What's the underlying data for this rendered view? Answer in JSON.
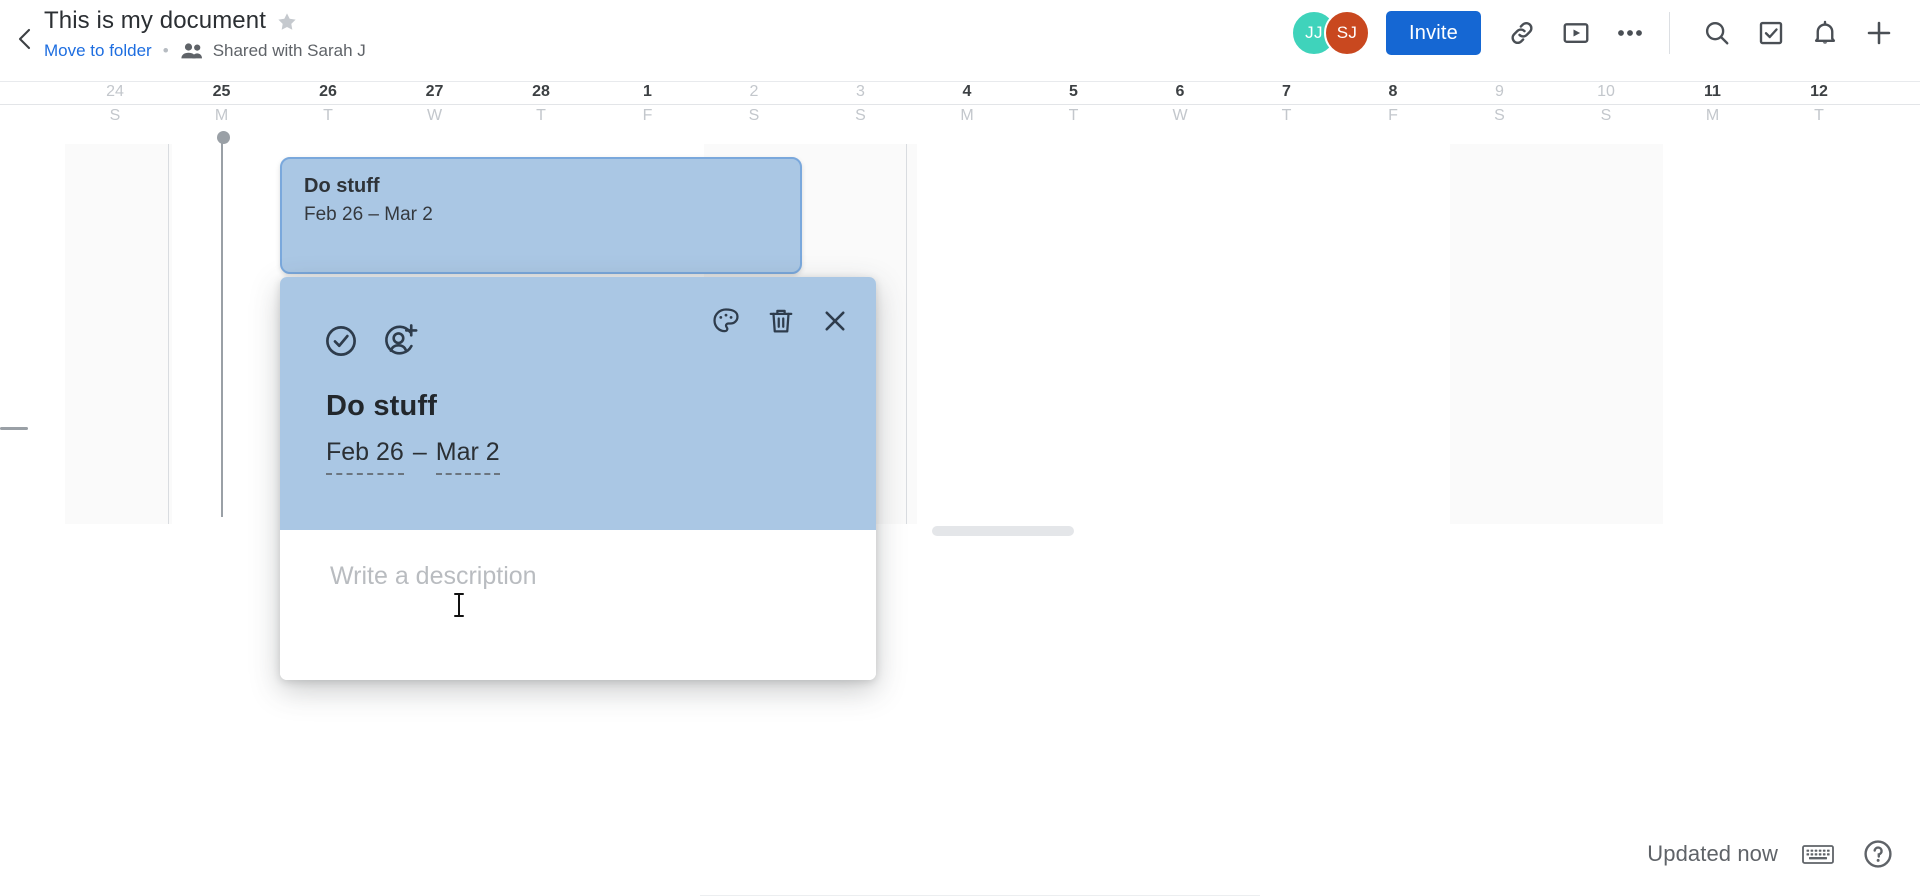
{
  "header": {
    "back_icon": "chevron-left-icon",
    "doc_title": "This is my document",
    "star_icon": "star-icon",
    "move_to_folder": "Move to folder",
    "separator_dot": "•",
    "people_icon": "people-icon",
    "shared_with": "Shared with Sarah J",
    "avatars": [
      {
        "initials": "JJ",
        "color": "#3fd3bb"
      },
      {
        "initials": "SJ",
        "color": "#c9481f"
      }
    ],
    "invite_label": "Invite",
    "invite_color": "#1567d3",
    "icons": [
      "link-icon",
      "video-play-icon",
      "more-horizontal-icon",
      "search-icon",
      "task-checkbox-icon",
      "bell-icon",
      "plus-icon"
    ]
  },
  "timeline": {
    "days": [
      {
        "num": "24",
        "letter": "S",
        "style": "faded",
        "weekend": true
      },
      {
        "num": "25",
        "letter": "M",
        "style": "strong",
        "weekend": false
      },
      {
        "num": "26",
        "letter": "T",
        "style": "strong",
        "weekend": false
      },
      {
        "num": "27",
        "letter": "W",
        "style": "strong",
        "weekend": false
      },
      {
        "num": "28",
        "letter": "T",
        "style": "strong",
        "weekend": false
      },
      {
        "num": "1",
        "letter": "F",
        "style": "strong",
        "weekend": false
      },
      {
        "num": "2",
        "letter": "S",
        "style": "faded",
        "weekend": true
      },
      {
        "num": "3",
        "letter": "S",
        "style": "faded",
        "weekend": true
      },
      {
        "num": "4",
        "letter": "M",
        "style": "strong",
        "weekend": false
      },
      {
        "num": "5",
        "letter": "T",
        "style": "strong",
        "weekend": false
      },
      {
        "num": "6",
        "letter": "W",
        "style": "strong",
        "weekend": false
      },
      {
        "num": "7",
        "letter": "T",
        "style": "strong",
        "weekend": false
      },
      {
        "num": "8",
        "letter": "F",
        "style": "strong",
        "weekend": false
      },
      {
        "num": "9",
        "letter": "S",
        "style": "faded",
        "weekend": true
      },
      {
        "num": "10",
        "letter": "S",
        "style": "faded",
        "weekend": true
      },
      {
        "num": "11",
        "letter": "M",
        "style": "strong",
        "weekend": false
      },
      {
        "num": "12",
        "letter": "T",
        "style": "strong",
        "weekend": false
      }
    ],
    "task_bar": {
      "title": "Do stuff",
      "date_range": "Feb 26 – Mar 2",
      "fill_color": "#aac7e4",
      "border_color": "#7aa8dc"
    }
  },
  "detail_card": {
    "complete_icon": "check-circle-icon",
    "assign_icon": "person-add-icon",
    "color_icon": "palette-icon",
    "delete_icon": "trash-icon",
    "close_icon": "close-icon",
    "title": "Do stuff",
    "date_start": "Feb 26",
    "date_dash": "–",
    "date_end": "Mar 2",
    "description_placeholder": "Write a description",
    "header_color": "#aac7e4"
  },
  "footer": {
    "updated_text": "Updated now",
    "keyboard_icon": "keyboard-icon",
    "help_icon": "help-circle-icon"
  }
}
